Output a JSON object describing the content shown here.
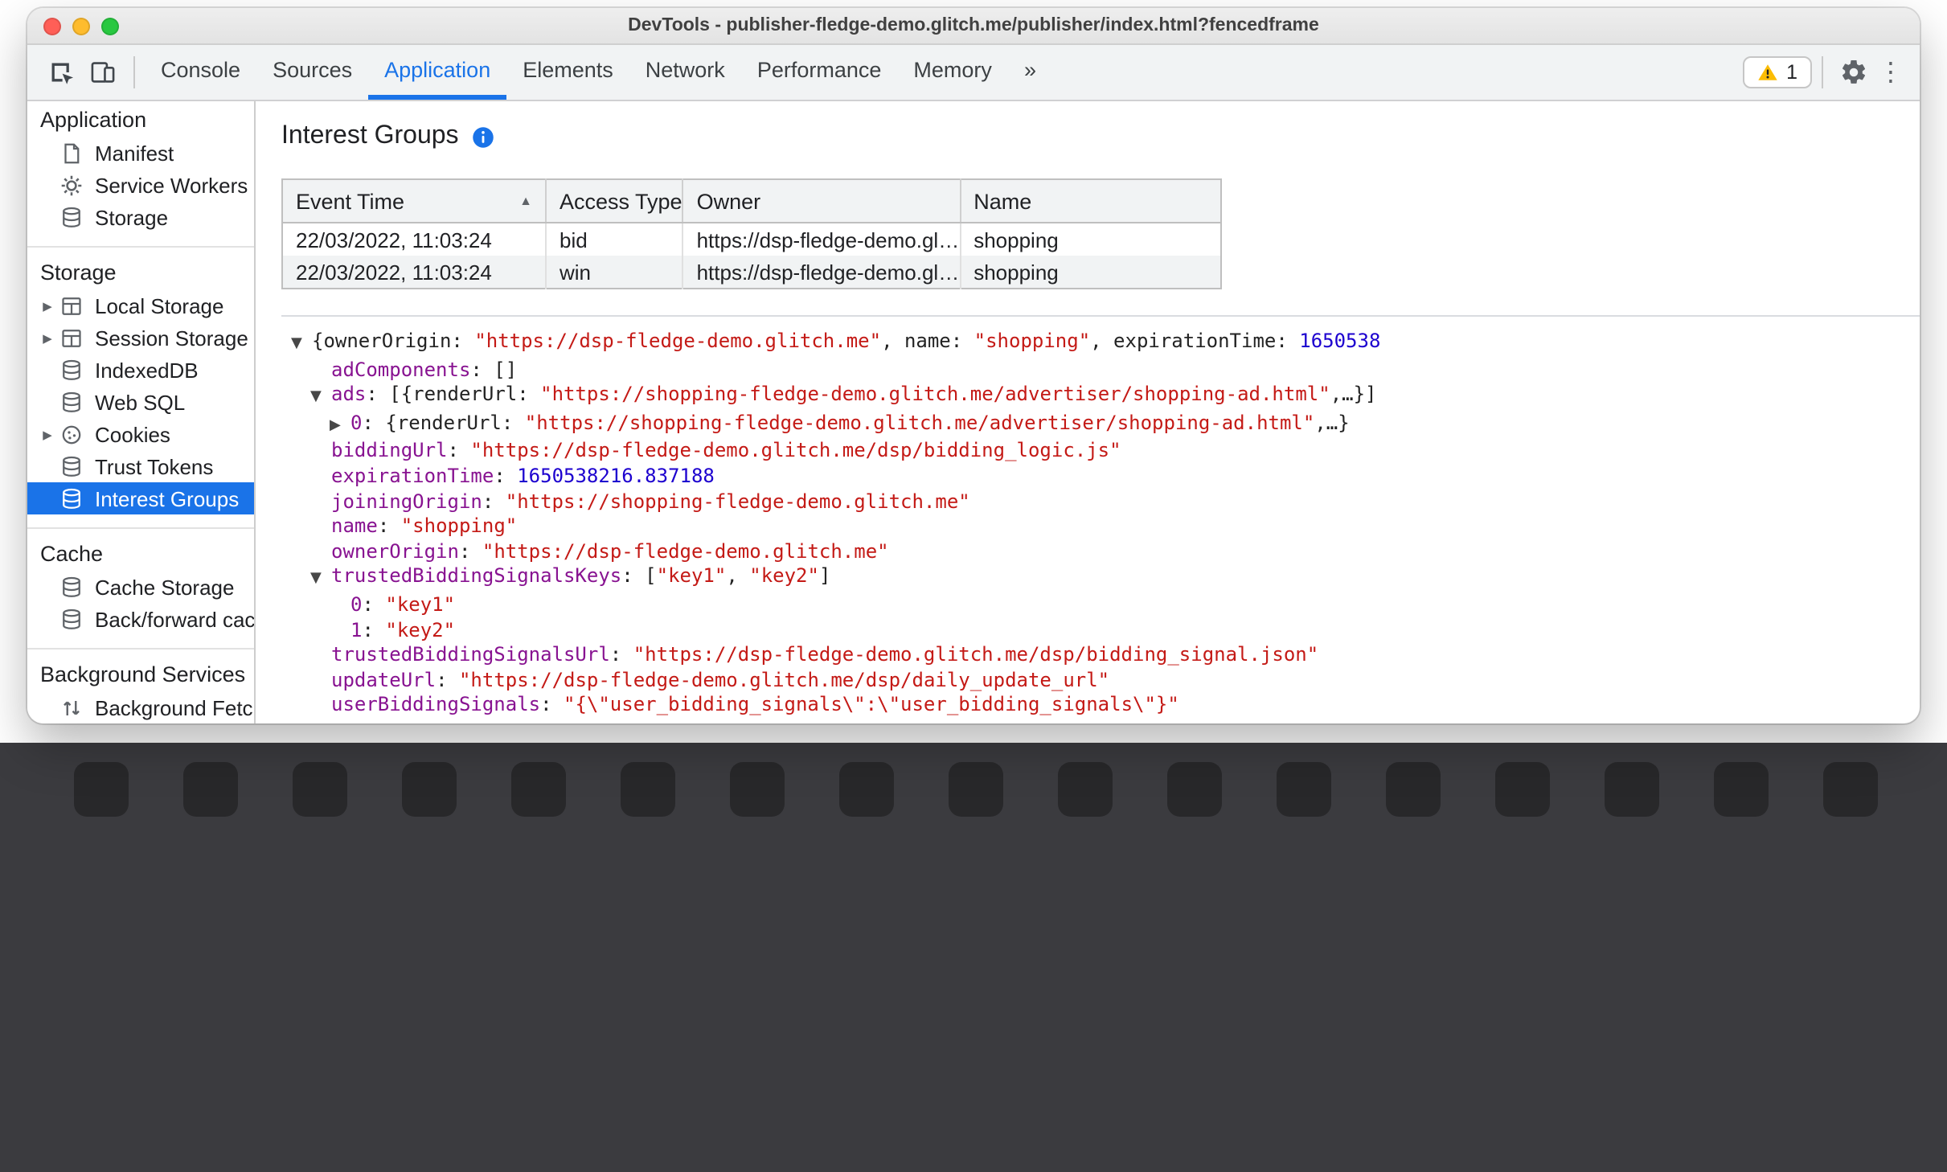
{
  "window": {
    "title": "DevTools - publisher-fledge-demo.glitch.me/publisher/index.html?fencedframe"
  },
  "toolbar": {
    "tabs": [
      {
        "label": "Console"
      },
      {
        "label": "Sources"
      },
      {
        "label": "Application",
        "active": true
      },
      {
        "label": "Elements"
      },
      {
        "label": "Network"
      },
      {
        "label": "Performance"
      },
      {
        "label": "Memory"
      },
      {
        "label": "»"
      }
    ],
    "warning_count": "1"
  },
  "sidebar": {
    "sections": [
      {
        "title": "Application",
        "items": [
          {
            "label": "Manifest",
            "icon": "document-icon"
          },
          {
            "label": "Service Workers",
            "icon": "gear-icon"
          },
          {
            "label": "Storage",
            "icon": "database-icon"
          }
        ]
      },
      {
        "title": "Storage",
        "items": [
          {
            "label": "Local Storage",
            "icon": "table-icon",
            "expander": true
          },
          {
            "label": "Session Storage",
            "icon": "table-icon",
            "expander": true
          },
          {
            "label": "IndexedDB",
            "icon": "database-icon"
          },
          {
            "label": "Web SQL",
            "icon": "database-icon"
          },
          {
            "label": "Cookies",
            "icon": "cookie-icon",
            "expander": true
          },
          {
            "label": "Trust Tokens",
            "icon": "database-icon"
          },
          {
            "label": "Interest Groups",
            "icon": "database-icon",
            "selected": true
          }
        ]
      },
      {
        "title": "Cache",
        "items": [
          {
            "label": "Cache Storage",
            "icon": "database-icon"
          },
          {
            "label": "Back/forward cach",
            "icon": "database-icon"
          }
        ]
      },
      {
        "title": "Background Services",
        "items": [
          {
            "label": "Background Fetch",
            "icon": "updown-icon"
          }
        ]
      }
    ]
  },
  "main": {
    "heading": "Interest Groups",
    "table": {
      "columns": [
        "Event Time",
        "Access Type",
        "Owner",
        "Name"
      ],
      "sort": {
        "column": "Event Time",
        "direction": "asc"
      },
      "rows": [
        [
          "22/03/2022, 11:03:24",
          "bid",
          "https://dsp-fledge-demo.gl…",
          "shopping"
        ],
        [
          "22/03/2022, 11:03:24",
          "win",
          "https://dsp-fledge-demo.gl…",
          "shopping"
        ]
      ]
    },
    "tree": {
      "lines": [
        {
          "indent": 0,
          "arrow": "▼",
          "seg": [
            {
              "t": "{ownerOrigin: ",
              "c": "p"
            },
            {
              "t": "\"https://dsp-fledge-demo.glitch.me\"",
              "c": "s"
            },
            {
              "t": ", name: ",
              "c": "p"
            },
            {
              "t": "\"shopping\"",
              "c": "s"
            },
            {
              "t": ", expirationTime: ",
              "c": "p"
            },
            {
              "t": "1650538",
              "c": "n"
            }
          ]
        },
        {
          "indent": 1,
          "seg": [
            {
              "t": "adComponents",
              "c": "k"
            },
            {
              "t": ": []",
              "c": "p"
            }
          ]
        },
        {
          "indent": 1,
          "arrow": "▼",
          "seg": [
            {
              "t": "ads",
              "c": "k"
            },
            {
              "t": ": [{renderUrl: ",
              "c": "p"
            },
            {
              "t": "\"https://shopping-fledge-demo.glitch.me/advertiser/shopping-ad.html\"",
              "c": "s"
            },
            {
              "t": ",…}]",
              "c": "p"
            }
          ]
        },
        {
          "indent": 2,
          "arrow": "▶",
          "seg": [
            {
              "t": "0",
              "c": "k"
            },
            {
              "t": ": {renderUrl: ",
              "c": "p"
            },
            {
              "t": "\"https://shopping-fledge-demo.glitch.me/advertiser/shopping-ad.html\"",
              "c": "s"
            },
            {
              "t": ",…}",
              "c": "p"
            }
          ]
        },
        {
          "indent": 1,
          "seg": [
            {
              "t": "biddingUrl",
              "c": "k"
            },
            {
              "t": ": ",
              "c": "p"
            },
            {
              "t": "\"https://dsp-fledge-demo.glitch.me/dsp/bidding_logic.js\"",
              "c": "s"
            }
          ]
        },
        {
          "indent": 1,
          "seg": [
            {
              "t": "expirationTime",
              "c": "k"
            },
            {
              "t": ": ",
              "c": "p"
            },
            {
              "t": "1650538216.837188",
              "c": "n"
            }
          ]
        },
        {
          "indent": 1,
          "seg": [
            {
              "t": "joiningOrigin",
              "c": "k"
            },
            {
              "t": ": ",
              "c": "p"
            },
            {
              "t": "\"https://shopping-fledge-demo.glitch.me\"",
              "c": "s"
            }
          ]
        },
        {
          "indent": 1,
          "seg": [
            {
              "t": "name",
              "c": "k"
            },
            {
              "t": ": ",
              "c": "p"
            },
            {
              "t": "\"shopping\"",
              "c": "s"
            }
          ]
        },
        {
          "indent": 1,
          "seg": [
            {
              "t": "ownerOrigin",
              "c": "k"
            },
            {
              "t": ": ",
              "c": "p"
            },
            {
              "t": "\"https://dsp-fledge-demo.glitch.me\"",
              "c": "s"
            }
          ]
        },
        {
          "indent": 1,
          "arrow": "▼",
          "seg": [
            {
              "t": "trustedBiddingSignalsKeys",
              "c": "k"
            },
            {
              "t": ": [",
              "c": "p"
            },
            {
              "t": "\"key1\"",
              "c": "s"
            },
            {
              "t": ", ",
              "c": "p"
            },
            {
              "t": "\"key2\"",
              "c": "s"
            },
            {
              "t": "]",
              "c": "p"
            }
          ]
        },
        {
          "indent": 2,
          "seg": [
            {
              "t": "0",
              "c": "k"
            },
            {
              "t": ": ",
              "c": "p"
            },
            {
              "t": "\"key1\"",
              "c": "s"
            }
          ]
        },
        {
          "indent": 2,
          "seg": [
            {
              "t": "1",
              "c": "k"
            },
            {
              "t": ": ",
              "c": "p"
            },
            {
              "t": "\"key2\"",
              "c": "s"
            }
          ]
        },
        {
          "indent": 1,
          "seg": [
            {
              "t": "trustedBiddingSignalsUrl",
              "c": "k"
            },
            {
              "t": ": ",
              "c": "p"
            },
            {
              "t": "\"https://dsp-fledge-demo.glitch.me/dsp/bidding_signal.json\"",
              "c": "s"
            }
          ]
        },
        {
          "indent": 1,
          "seg": [
            {
              "t": "updateUrl",
              "c": "k"
            },
            {
              "t": ": ",
              "c": "p"
            },
            {
              "t": "\"https://dsp-fledge-demo.glitch.me/dsp/daily_update_url\"",
              "c": "s"
            }
          ]
        },
        {
          "indent": 1,
          "seg": [
            {
              "t": "userBiddingSignals",
              "c": "k"
            },
            {
              "t": ": ",
              "c": "p"
            },
            {
              "t": "\"{\\\"user_bidding_signals\\\":\\\"user_bidding_signals\\\"}\"",
              "c": "s"
            }
          ]
        }
      ]
    }
  },
  "colors": {
    "accent": "#1a73e8",
    "warning_yellow": "#fbbc04",
    "tree_key": "#881391",
    "tree_string": "#c41a16",
    "tree_number": "#1c00cf"
  }
}
